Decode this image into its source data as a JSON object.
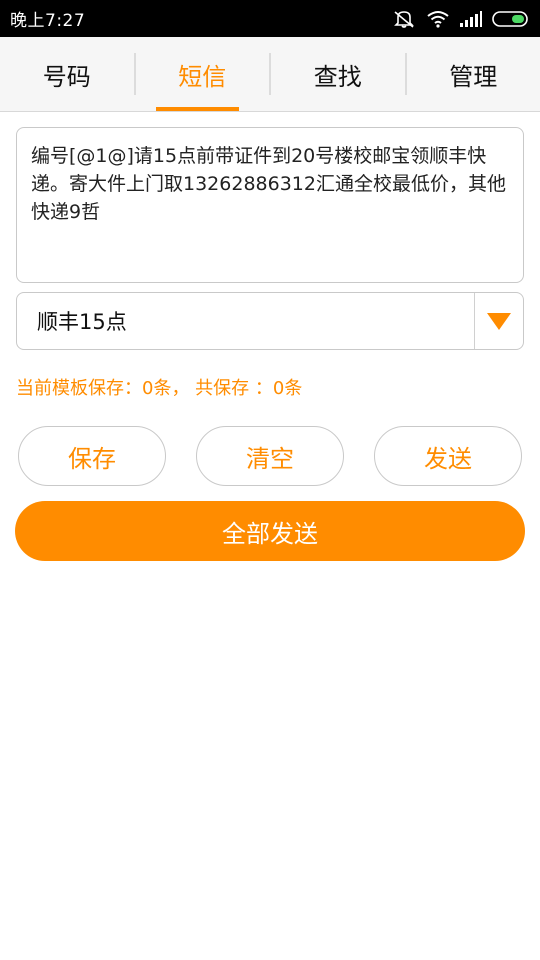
{
  "status_bar": {
    "time": "晚上7:27",
    "icons": [
      "mute-icon",
      "wifi-icon",
      "signal-icon",
      "battery-icon"
    ]
  },
  "tabs": [
    {
      "label": "号码",
      "active": false
    },
    {
      "label": "短信",
      "active": true
    },
    {
      "label": "查找",
      "active": false
    },
    {
      "label": "管理",
      "active": false
    }
  ],
  "message": {
    "text": "编号[@1@]请15点前带证件到20号楼校邮宝领顺丰快递。寄大件上门取13262886312汇通全校最低价，其他快递9哲"
  },
  "template_select": {
    "value": "顺丰15点",
    "icon": "dropdown-triangle-icon"
  },
  "counter": {
    "text": "当前模板保存：0条，  共保存 ：0条"
  },
  "buttons": {
    "save": "保存",
    "clear": "清空",
    "send": "发送",
    "send_all": "全部发送"
  },
  "colors": {
    "accent": "#ff8c00",
    "status_bar": "#000000",
    "battery": "#4cd964"
  }
}
